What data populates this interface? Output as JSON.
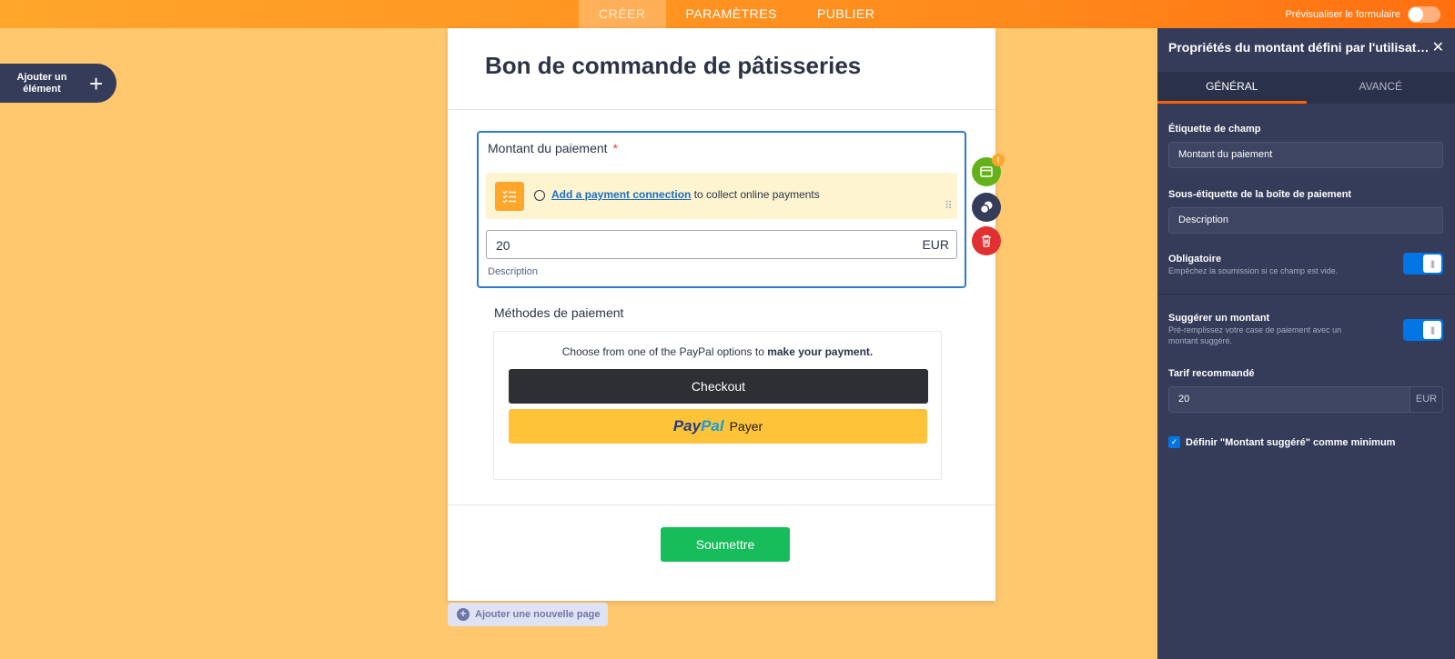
{
  "topbar": {
    "tabs": [
      {
        "label": "CRÉER"
      },
      {
        "label": "PARAMÈTRES"
      },
      {
        "label": "PUBLIER"
      }
    ],
    "preview_label": "Prévisualiser le formulaire"
  },
  "add_element": {
    "label": "Ajouter un élément",
    "plus": "+"
  },
  "form": {
    "title": "Bon de commande de pâtisseries",
    "payment_field": {
      "label": "Montant du paiement",
      "required_mark": "*",
      "notice_link": "Add a payment connection",
      "notice_text": " to collect online payments",
      "amount": "20",
      "currency": "EUR",
      "sublabel": "Description"
    },
    "methods": {
      "title": "Méthodes de paiement",
      "intro": "Choose from one of the PayPal options to ",
      "intro_bold": "make your payment.",
      "checkout_label": "Checkout",
      "paypal_logo_1": "Pay",
      "paypal_logo_2": "Pal",
      "paypal_label": "Payer"
    },
    "submit_label": "Soumettre",
    "warning_badge": "!"
  },
  "add_page_label": "Ajouter une nouvelle page",
  "panel": {
    "title": "Propriétés du montant défini par l'utilisateur",
    "close": "✕",
    "tabs": [
      {
        "label": "GÉNÉRAL"
      },
      {
        "label": "AVANCÉ"
      }
    ],
    "field_label_title": "Étiquette de champ",
    "field_label_value": "Montant du paiement",
    "sublabel_title": "Sous-étiquette de la boîte de paiement",
    "sublabel_value": "Description",
    "required_title": "Obligatoire",
    "required_desc": "Empêchez la soumission si ce champ est vide.",
    "required_on": true,
    "suggest_title": "Suggérer un montant",
    "suggest_desc": "Pré-remplissez votre case de paiement avec un montant suggéré.",
    "suggest_on": true,
    "rate_title": "Tarif recommandé",
    "rate_value": "20",
    "rate_currency": "EUR",
    "min_checkbox_label": "Définir \"Montant suggéré\" comme minimum",
    "min_checked": true
  },
  "colors": {
    "canvas_bg": "#ffc76e",
    "accent_orange": "#ff6100",
    "panel_bg": "#343c5a",
    "toggle_blue": "#0075e3",
    "submit_green": "#18bd5b"
  }
}
